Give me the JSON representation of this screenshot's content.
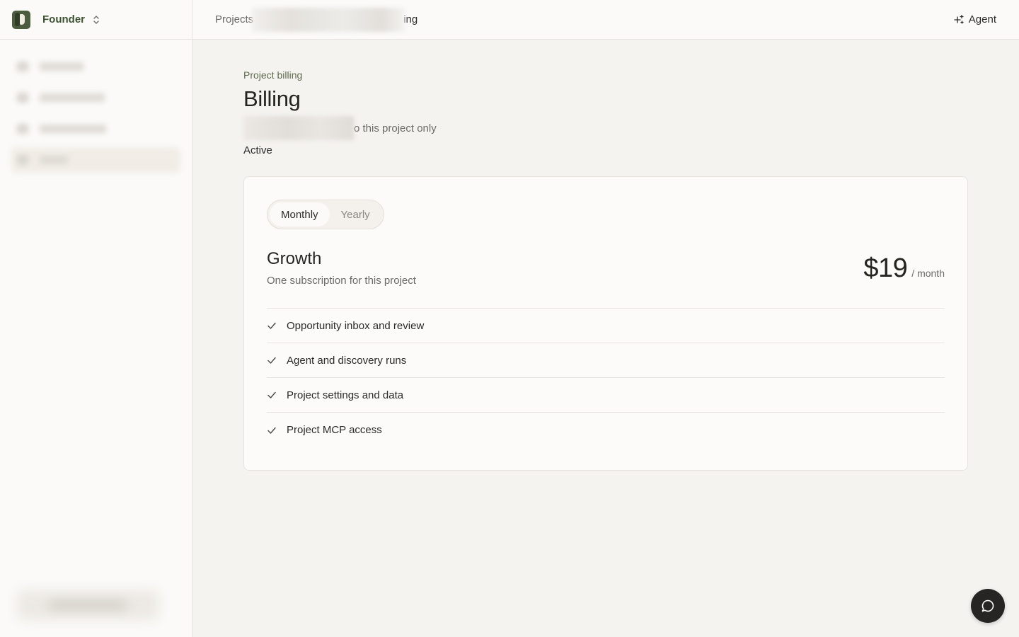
{
  "sidebar": {
    "workspace": "Founder",
    "items": [
      {
        "icon": "home-icon"
      },
      {
        "icon": "grid-icon"
      },
      {
        "icon": "link-icon"
      },
      {
        "icon": "billing-icon",
        "active": true
      }
    ]
  },
  "topbar": {
    "breadcrumb_root": "Projects",
    "breadcrumb_tail": "ing",
    "agent_label": "Agent"
  },
  "page": {
    "eyebrow": "Project billing",
    "title": "Billing",
    "subtitle_visible": "o this project only",
    "status": "Active"
  },
  "plan": {
    "toggle": {
      "monthly": "Monthly",
      "yearly": "Yearly",
      "selected": "Monthly"
    },
    "name": "Growth",
    "description": "One subscription for this project",
    "price": "$19",
    "period": "/ month",
    "features": [
      "Opportunity inbox and review",
      "Agent and discovery runs",
      "Project settings and data",
      "Project MCP access"
    ]
  },
  "colors": {
    "accent": "#3d5232",
    "background": "#f5f3f0",
    "card": "#fcfbfa",
    "fab": "#262523"
  }
}
